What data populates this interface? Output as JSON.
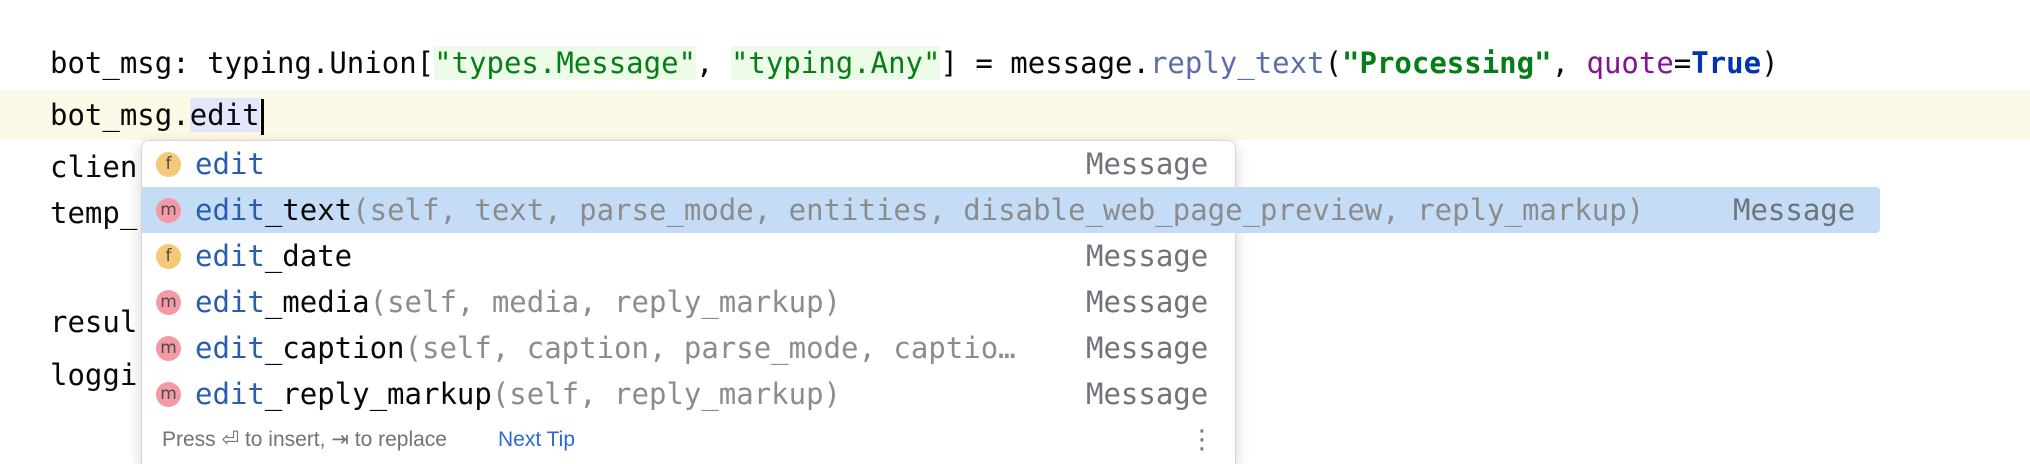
{
  "editor": {
    "line1": {
      "prefix": "bot_msg: typing.Union[",
      "str1": "\"types.Message\"",
      "sep1": ", ",
      "str2": "\"typing.Any\"",
      "mid": "] = message.",
      "method": "reply_text",
      "open": "(",
      "str3": "\"Processing\"",
      "sep2": ", ",
      "kwarg": "quote",
      "eq": "=",
      "kw": "True",
      "close": ")"
    },
    "line2": {
      "prefix": "bot_msg.",
      "typed": "edit"
    },
    "line3": "clien",
    "line4": "temp_",
    "line6": "resul",
    "line7": "loggi"
  },
  "completion": {
    "items": [
      {
        "kind": "f",
        "match": "edit",
        "rest": "",
        "params": "",
        "type": "Message"
      },
      {
        "kind": "m",
        "match": "edit",
        "rest": "_text",
        "params": "(self, text, parse_mode, entities, disable_web_page_preview, reply_markup)",
        "type": "Message"
      },
      {
        "kind": "f",
        "match": "edit",
        "rest": "_date",
        "params": "",
        "type": "Message"
      },
      {
        "kind": "m",
        "match": "edit",
        "rest": "_media",
        "params": "(self, media, reply_markup)",
        "type": "Message"
      },
      {
        "kind": "m",
        "match": "edit",
        "rest": "_caption",
        "params": "(self, caption, parse_mode, captio…",
        "type": "Message"
      },
      {
        "kind": "m",
        "match": "edit",
        "rest": "_reply_markup",
        "params": "(self, reply_markup)",
        "type": "Message"
      }
    ],
    "selected_index": 1,
    "footer": {
      "hint": "Press ⏎ to insert, ⇥ to replace",
      "link": "Next Tip",
      "menu_icon": "⋮"
    }
  },
  "colors": {
    "selection": "#c5dcf7",
    "current_line": "#fdf9e7",
    "string": "#067d17",
    "keyword": "#0033b3"
  }
}
